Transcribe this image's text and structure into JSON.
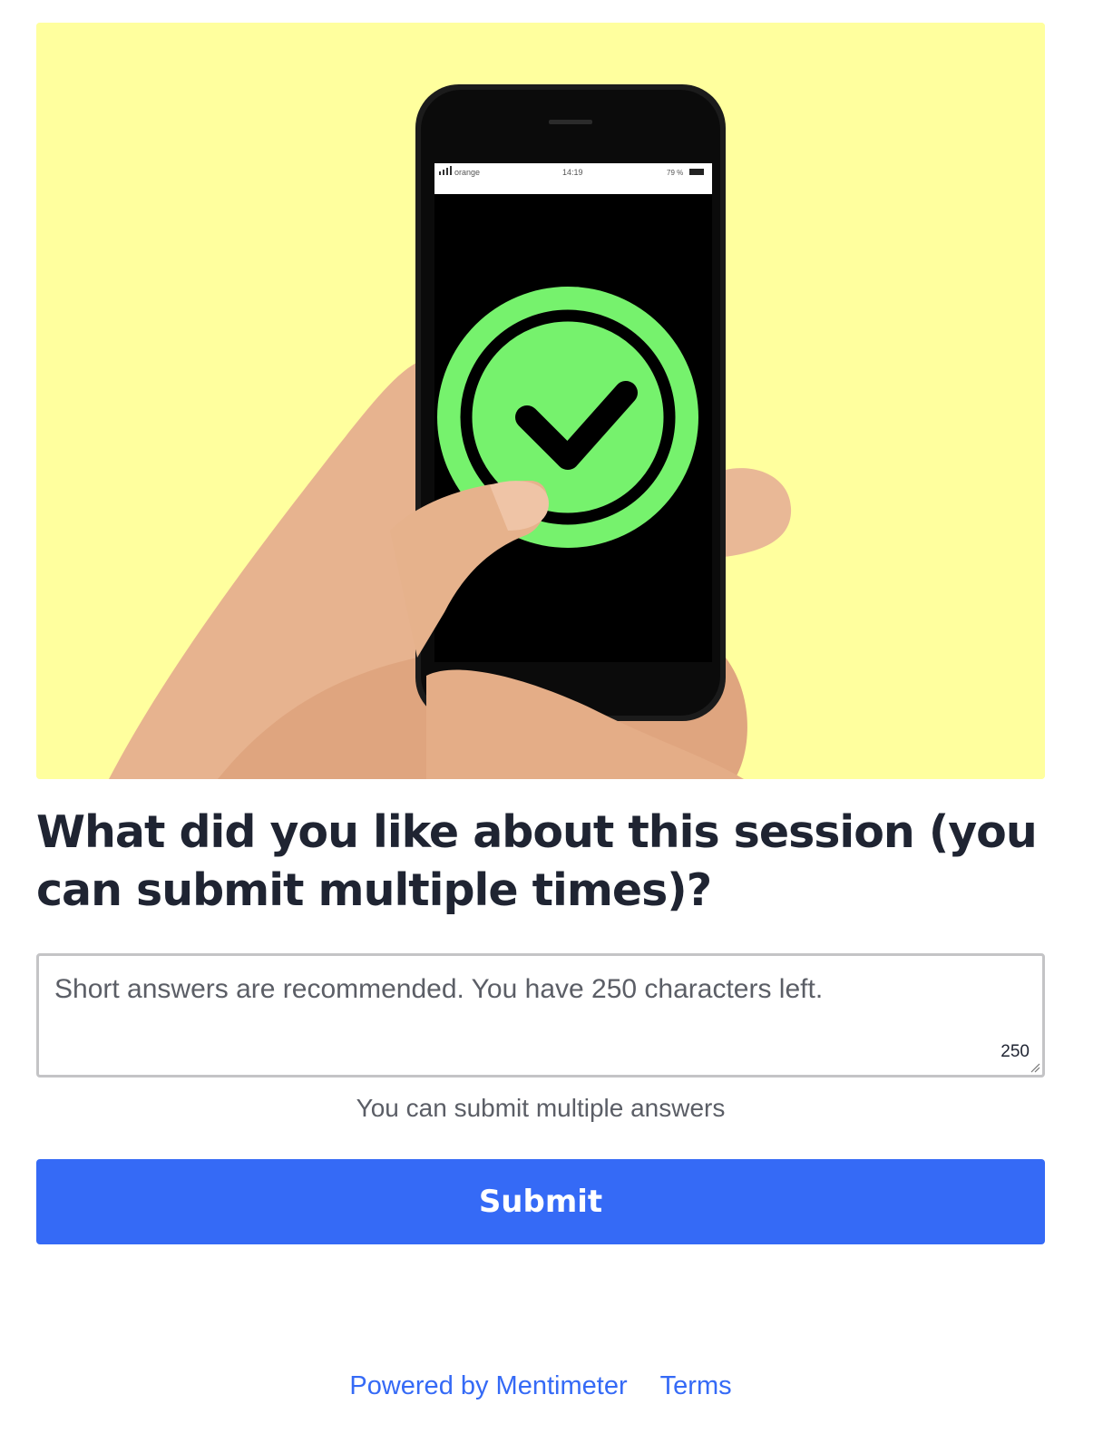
{
  "hero": {
    "image_description_icon": "hand-holding-phone-with-green-checkmark",
    "background_color": "#ffff9e",
    "phone_status_bar": {
      "carrier": "orange",
      "time": "14:19",
      "battery": "79 %"
    }
  },
  "question": {
    "title": "What did you like about this session (you can submit multiple times)?"
  },
  "answer": {
    "placeholder": "Short answers are recommended. You have 250 characters left.",
    "value": "",
    "char_counter": "250"
  },
  "hint": "You can submit multiple answers",
  "submit": {
    "label": "Submit",
    "color": "#356af6"
  },
  "footer": {
    "powered_by": "Powered by Mentimeter",
    "terms": "Terms"
  }
}
